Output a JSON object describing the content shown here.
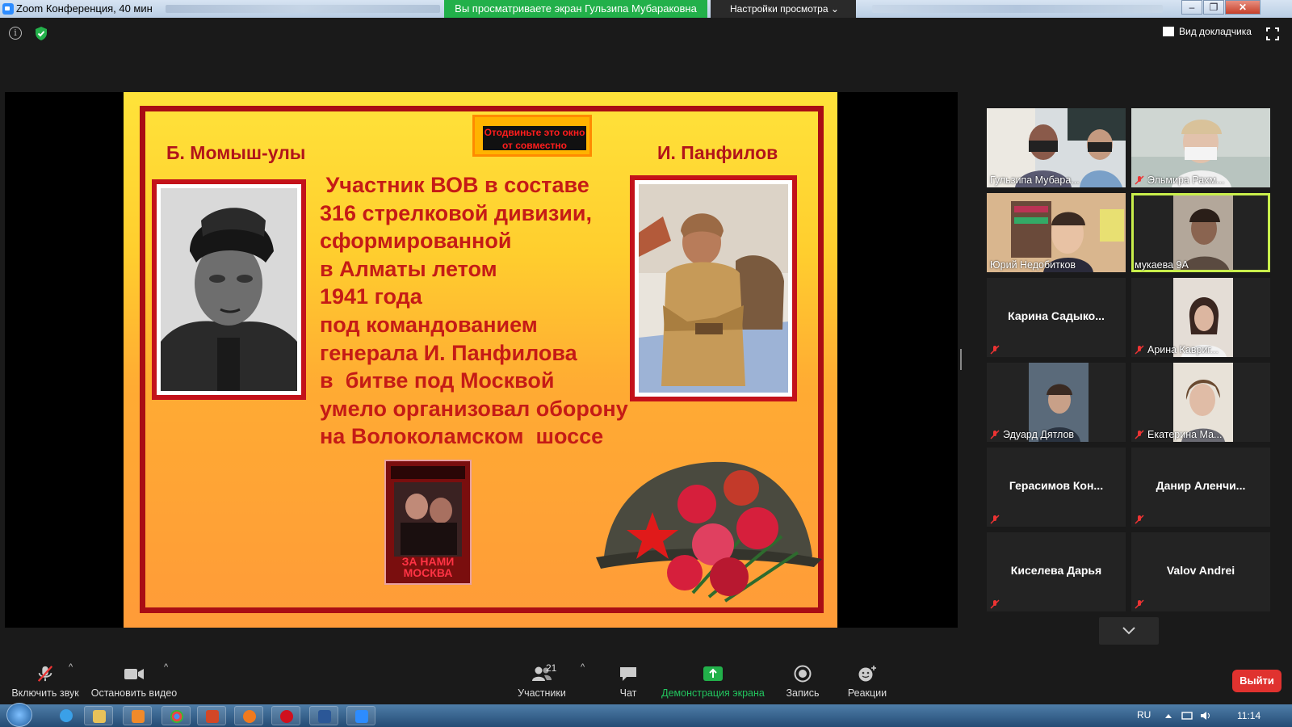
{
  "window": {
    "title": "Zoom Конференция, 40 мин",
    "viewing_banner": "Вы просматриваете экран Гульзипа Мубараковна",
    "view_options": "Настройки просмотра"
  },
  "top_controls": {
    "speaker_view": "Вид докладчика"
  },
  "slide": {
    "name_left": "Б. Момыш-улы",
    "name_right": "И. Панфилов",
    "notice": "Отодвиньте это окно от совместно",
    "body_lines": [
      " Участник ВОВ в составе",
      "316 стрелковой дивизии,",
      "сформированной",
      "в Алматы летом",
      "1941 года",
      "под командованием",
      "генерала И. Панфилова",
      "в  битве под Москвой",
      "умело организовал оборону",
      "на Волоколамском  шоссе"
    ],
    "book_title": "ЗА НАМИ МОСКВА"
  },
  "gallery": {
    "tiles": [
      {
        "name": "Гульзипа Мубара...",
        "muted": false,
        "video": true
      },
      {
        "name": "Эльмира Рахм...",
        "muted": true,
        "video": true
      },
      {
        "name": "Юрий Недобитков",
        "muted": false,
        "video": true
      },
      {
        "name": "мукаева 9А",
        "muted": false,
        "video": true,
        "active": true
      },
      {
        "name": "Карина  Садыко...",
        "muted": true,
        "video": false
      },
      {
        "name": "Арина Кавриг...",
        "muted": true,
        "video": true
      },
      {
        "name": "Эдуард Дятлов",
        "muted": true,
        "video": true
      },
      {
        "name": "Екатерина Ма...",
        "muted": true,
        "video": true
      },
      {
        "name": "Герасимов  Кон...",
        "muted": true,
        "video": false
      },
      {
        "name": "Данир  Аленчи...",
        "muted": true,
        "video": false
      },
      {
        "name": "Киселева Дарья",
        "muted": true,
        "video": false
      },
      {
        "name": "Valov Andrei",
        "muted": true,
        "video": false
      }
    ]
  },
  "toolbar": {
    "unmute": "Включить звук",
    "stop_video": "Остановить видео",
    "participants": "Участники",
    "participants_count": "21",
    "chat": "Чат",
    "share_screen": "Демонстрация экрана",
    "record": "Запись",
    "reactions": "Реакции",
    "leave": "Выйти"
  },
  "taskbar": {
    "language": "RU",
    "time": "11:14"
  },
  "colors": {
    "share_green": "#22b04a",
    "leave_red": "#e0322f",
    "active_speaker": "#c8ee4b",
    "slide_red": "#b2141a"
  }
}
